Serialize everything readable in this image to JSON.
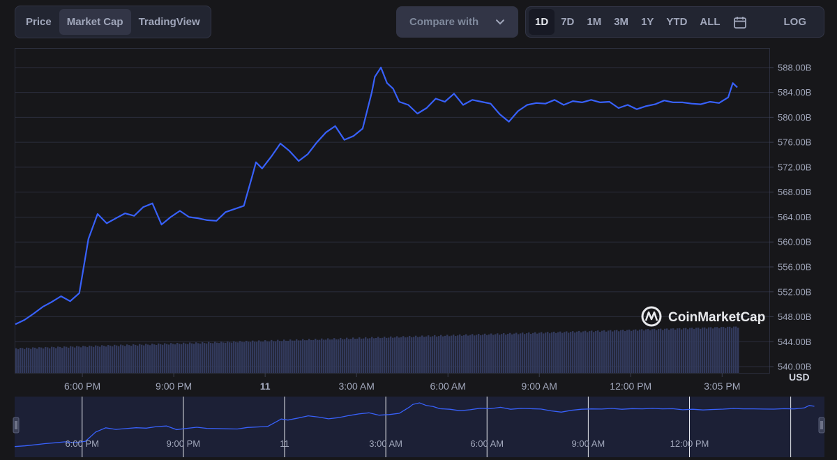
{
  "toolbar": {
    "tabs": [
      {
        "label": "Price",
        "active": false
      },
      {
        "label": "Market Cap",
        "active": true
      },
      {
        "label": "TradingView",
        "active": false
      }
    ],
    "compare_label": "Compare with",
    "ranges": [
      {
        "label": "1D",
        "active": true
      },
      {
        "label": "7D",
        "active": false
      },
      {
        "label": "1M",
        "active": false
      },
      {
        "label": "3M",
        "active": false
      },
      {
        "label": "1Y",
        "active": false
      },
      {
        "label": "YTD",
        "active": false
      },
      {
        "label": "ALL",
        "active": false
      }
    ],
    "log_label": "LOG"
  },
  "watermark": "CoinMarketCap",
  "colors": {
    "line": "#3861fb",
    "grid": "#2b2e3c",
    "volume": "#323a5c",
    "navigator_bg": "#1c2036",
    "text": "#a1a7bb"
  },
  "chart_data": {
    "type": "line",
    "title": "",
    "ylabel": "USD",
    "ylim": [
      539,
      591
    ],
    "y_ticks": [
      "540.00B",
      "544.00B",
      "548.00B",
      "552.00B",
      "556.00B",
      "560.00B",
      "564.00B",
      "568.00B",
      "572.00B",
      "576.00B",
      "580.00B",
      "584.00B",
      "588.00B"
    ],
    "x_ticks": [
      {
        "label": "6:00 PM",
        "hours": 2.2,
        "bold": false
      },
      {
        "label": "9:00 PM",
        "hours": 5.2,
        "bold": false
      },
      {
        "label": "11",
        "hours": 8.2,
        "bold": true
      },
      {
        "label": "3:00 AM",
        "hours": 11.2,
        "bold": false
      },
      {
        "label": "6:00 AM",
        "hours": 14.2,
        "bold": false
      },
      {
        "label": "9:00 AM",
        "hours": 17.2,
        "bold": false
      },
      {
        "label": "12:00 PM",
        "hours": 20.2,
        "bold": false
      },
      {
        "label": "3:05 PM",
        "hours": 23.2,
        "bold": false
      }
    ],
    "series": [
      {
        "x": [
          0.0,
          0.3,
          0.6,
          0.9,
          1.2,
          1.5,
          1.8,
          2.1,
          2.4,
          2.7,
          3.0,
          3.3,
          3.6,
          3.9,
          4.2,
          4.5,
          4.8,
          5.1,
          5.4,
          5.7,
          6.0,
          6.3,
          6.6,
          6.9,
          7.2,
          7.5,
          7.8,
          7.9,
          8.1,
          8.4,
          8.7,
          9.0,
          9.3,
          9.6,
          9.9,
          10.2,
          10.5,
          10.8,
          11.1,
          11.4,
          11.7,
          11.8,
          12.0,
          12.2,
          12.4,
          12.6,
          12.9,
          13.2,
          13.5,
          13.8,
          14.1,
          14.4,
          14.7,
          15.0,
          15.3,
          15.6,
          15.9,
          16.2,
          16.5,
          16.8,
          17.1,
          17.4,
          17.7,
          18.0,
          18.3,
          18.6,
          18.9,
          19.2,
          19.5,
          19.8,
          20.1,
          20.4,
          20.7,
          21.0,
          21.3,
          21.6,
          21.9,
          22.2,
          22.5,
          22.8,
          23.1,
          23.4,
          23.55,
          23.7
        ],
        "values": [
          546.8,
          547.5,
          548.5,
          549.6,
          550.4,
          551.3,
          550.5,
          551.8,
          560.5,
          564.5,
          563.0,
          563.8,
          564.6,
          564.2,
          565.6,
          566.2,
          562.8,
          564.0,
          565.0,
          564.0,
          563.8,
          563.5,
          563.4,
          564.8,
          565.3,
          565.8,
          571.0,
          572.8,
          571.8,
          573.7,
          575.8,
          574.6,
          573.0,
          574.1,
          576.0,
          577.6,
          578.6,
          576.4,
          577.0,
          578.2,
          584.0,
          586.5,
          588.0,
          585.5,
          584.6,
          582.5,
          582.0,
          580.6,
          581.5,
          583.0,
          582.5,
          583.8,
          582.0,
          582.8,
          582.5,
          582.2,
          580.5,
          579.3,
          581.0,
          582.0,
          582.3,
          582.2,
          582.8,
          582.0,
          582.6,
          582.4,
          582.8,
          582.4,
          582.5,
          581.5,
          582.0,
          581.3,
          581.8,
          582.1,
          582.7,
          582.4,
          582.4,
          582.2,
          582.1,
          582.5,
          582.3,
          583.2,
          585.5,
          584.8
        ]
      }
    ]
  }
}
